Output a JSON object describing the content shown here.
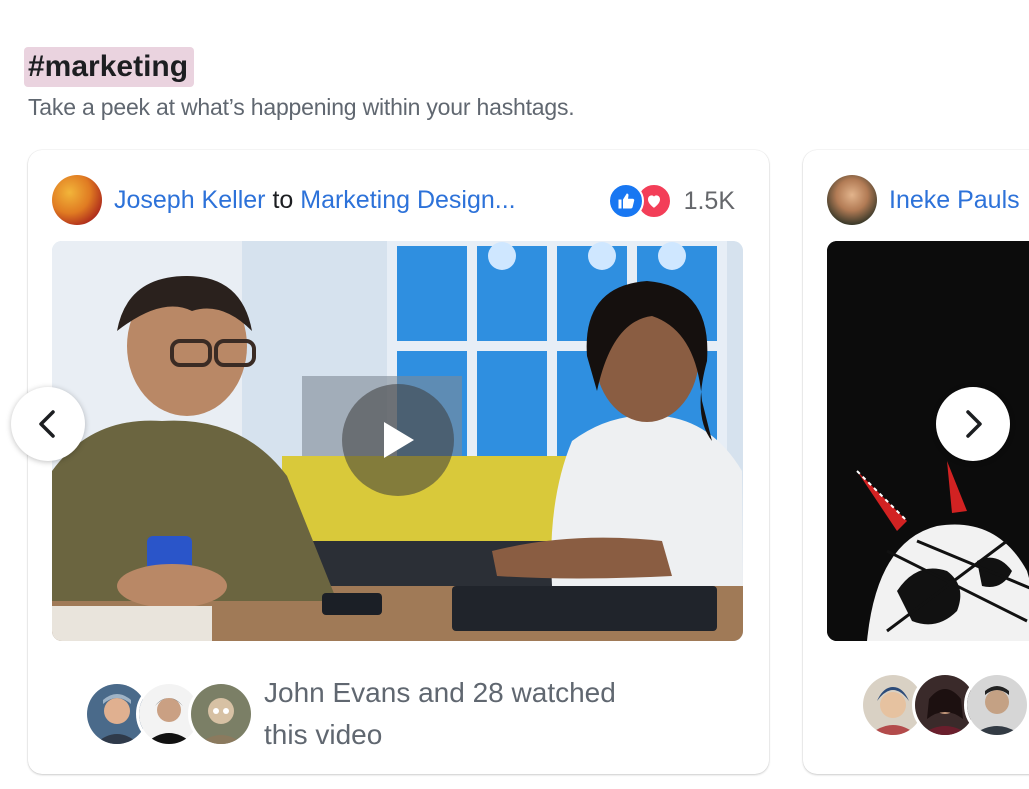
{
  "hashtag": "#marketing",
  "subtitle": "Take a peek at what’s happening within your hashtags.",
  "cards": [
    {
      "author": "Joseph Keller",
      "to_word": "to",
      "group": "Marketing Design...",
      "reaction_count": "1.5K",
      "reaction_icons": [
        "like-icon",
        "love-icon"
      ],
      "watched_name": "John Evans",
      "watched_rest": "and 28 watched",
      "watched_line2": "this video"
    },
    {
      "author": "Ineke Pauls"
    }
  ],
  "colors": {
    "hashtag_bg": "#ead3df",
    "link": "#2d72d9",
    "like": "#1877f2",
    "love": "#f33e58",
    "muted_text": "#606770"
  },
  "icons": {
    "prev": "chevron-left-icon",
    "next": "chevron-right-icon",
    "play": "play-icon"
  }
}
